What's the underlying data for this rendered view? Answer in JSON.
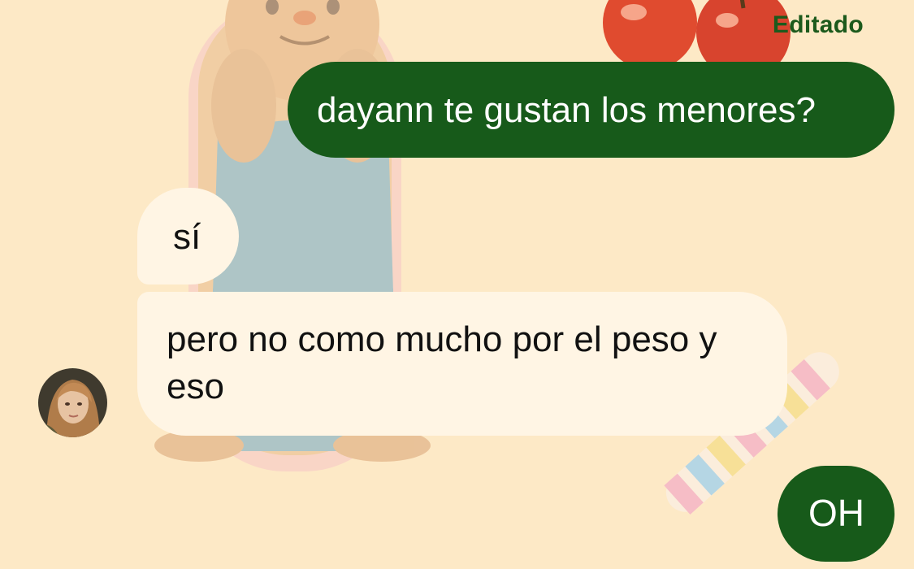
{
  "chat": {
    "edited_label": "Editado",
    "messages": [
      {
        "direction": "outgoing",
        "text": "dayann te gustan los menores?"
      },
      {
        "direction": "incoming",
        "text": "sí"
      },
      {
        "direction": "incoming",
        "text": "pero no como mucho por el peso y eso"
      },
      {
        "direction": "outgoing",
        "text": "OH"
      }
    ]
  },
  "colors": {
    "background": "#fde9c6",
    "outgoing_bubble": "#175a1a",
    "incoming_bubble": "#fff5e4",
    "edited_label": "#1c5a1c"
  },
  "icons": {
    "sender_avatar": "profile-photo"
  },
  "decorations": [
    "teddy-bear-sticker",
    "apples-sticker",
    "marshmallow-twist-sticker"
  ]
}
